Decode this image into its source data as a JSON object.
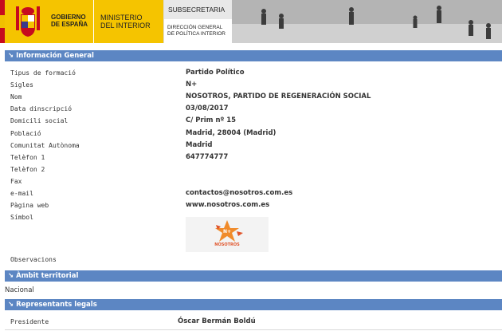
{
  "header": {
    "gov_line1": "GOBIERNO",
    "gov_line2": "DE ESPAÑA",
    "min_line1": "MINISTERIO",
    "min_line2": "DEL INTERIOR",
    "sub_title": "SUBSECRETARIA",
    "sub_line1": "DIRECCIÓN GENERAL",
    "sub_line2": "DE POLÍTICA INTERIOR"
  },
  "sections": {
    "general": "Información General",
    "ambit": "Àmbit territorial",
    "representants": "Representants legals"
  },
  "general_rows": [
    {
      "label": "Tipus de formació",
      "value": "Partido Político"
    },
    {
      "label": "Sigles",
      "value": "N+"
    },
    {
      "label": "Nom",
      "value": "NOSOTROS, PARTIDO DE REGENERACIÓN SOCIAL"
    },
    {
      "label": "Data dinscripció",
      "value": "03/08/2017"
    },
    {
      "label": "Domicili social",
      "value": "C/ Prim nº 15"
    },
    {
      "label": "Població",
      "value": "Madrid, 28004 (Madrid)"
    },
    {
      "label": "Comunitat Autònoma",
      "value": "Madrid"
    },
    {
      "label": "Telèfon 1",
      "value": "647774777"
    },
    {
      "label": "Telèfon 2",
      "value": ""
    },
    {
      "label": "Fax",
      "value": ""
    },
    {
      "label": "e-mail",
      "value": "contactos@nosotros.com.es"
    },
    {
      "label": "Pàgina web",
      "value": "www.nosotros.com.es"
    },
    {
      "label": "Símbol",
      "value": ""
    }
  ],
  "logo": {
    "text": "NOSOTROS",
    "mark": "N+"
  },
  "observacions_label": "Observacions",
  "ambit_value": "Nacional",
  "representant": {
    "label": "Presidente",
    "value": "Óscar Bermán Boldú"
  },
  "colors": {
    "section_bar": "#5c86c3",
    "gov_yellow": "#f5c400",
    "logo_orange": "#e0542a"
  }
}
